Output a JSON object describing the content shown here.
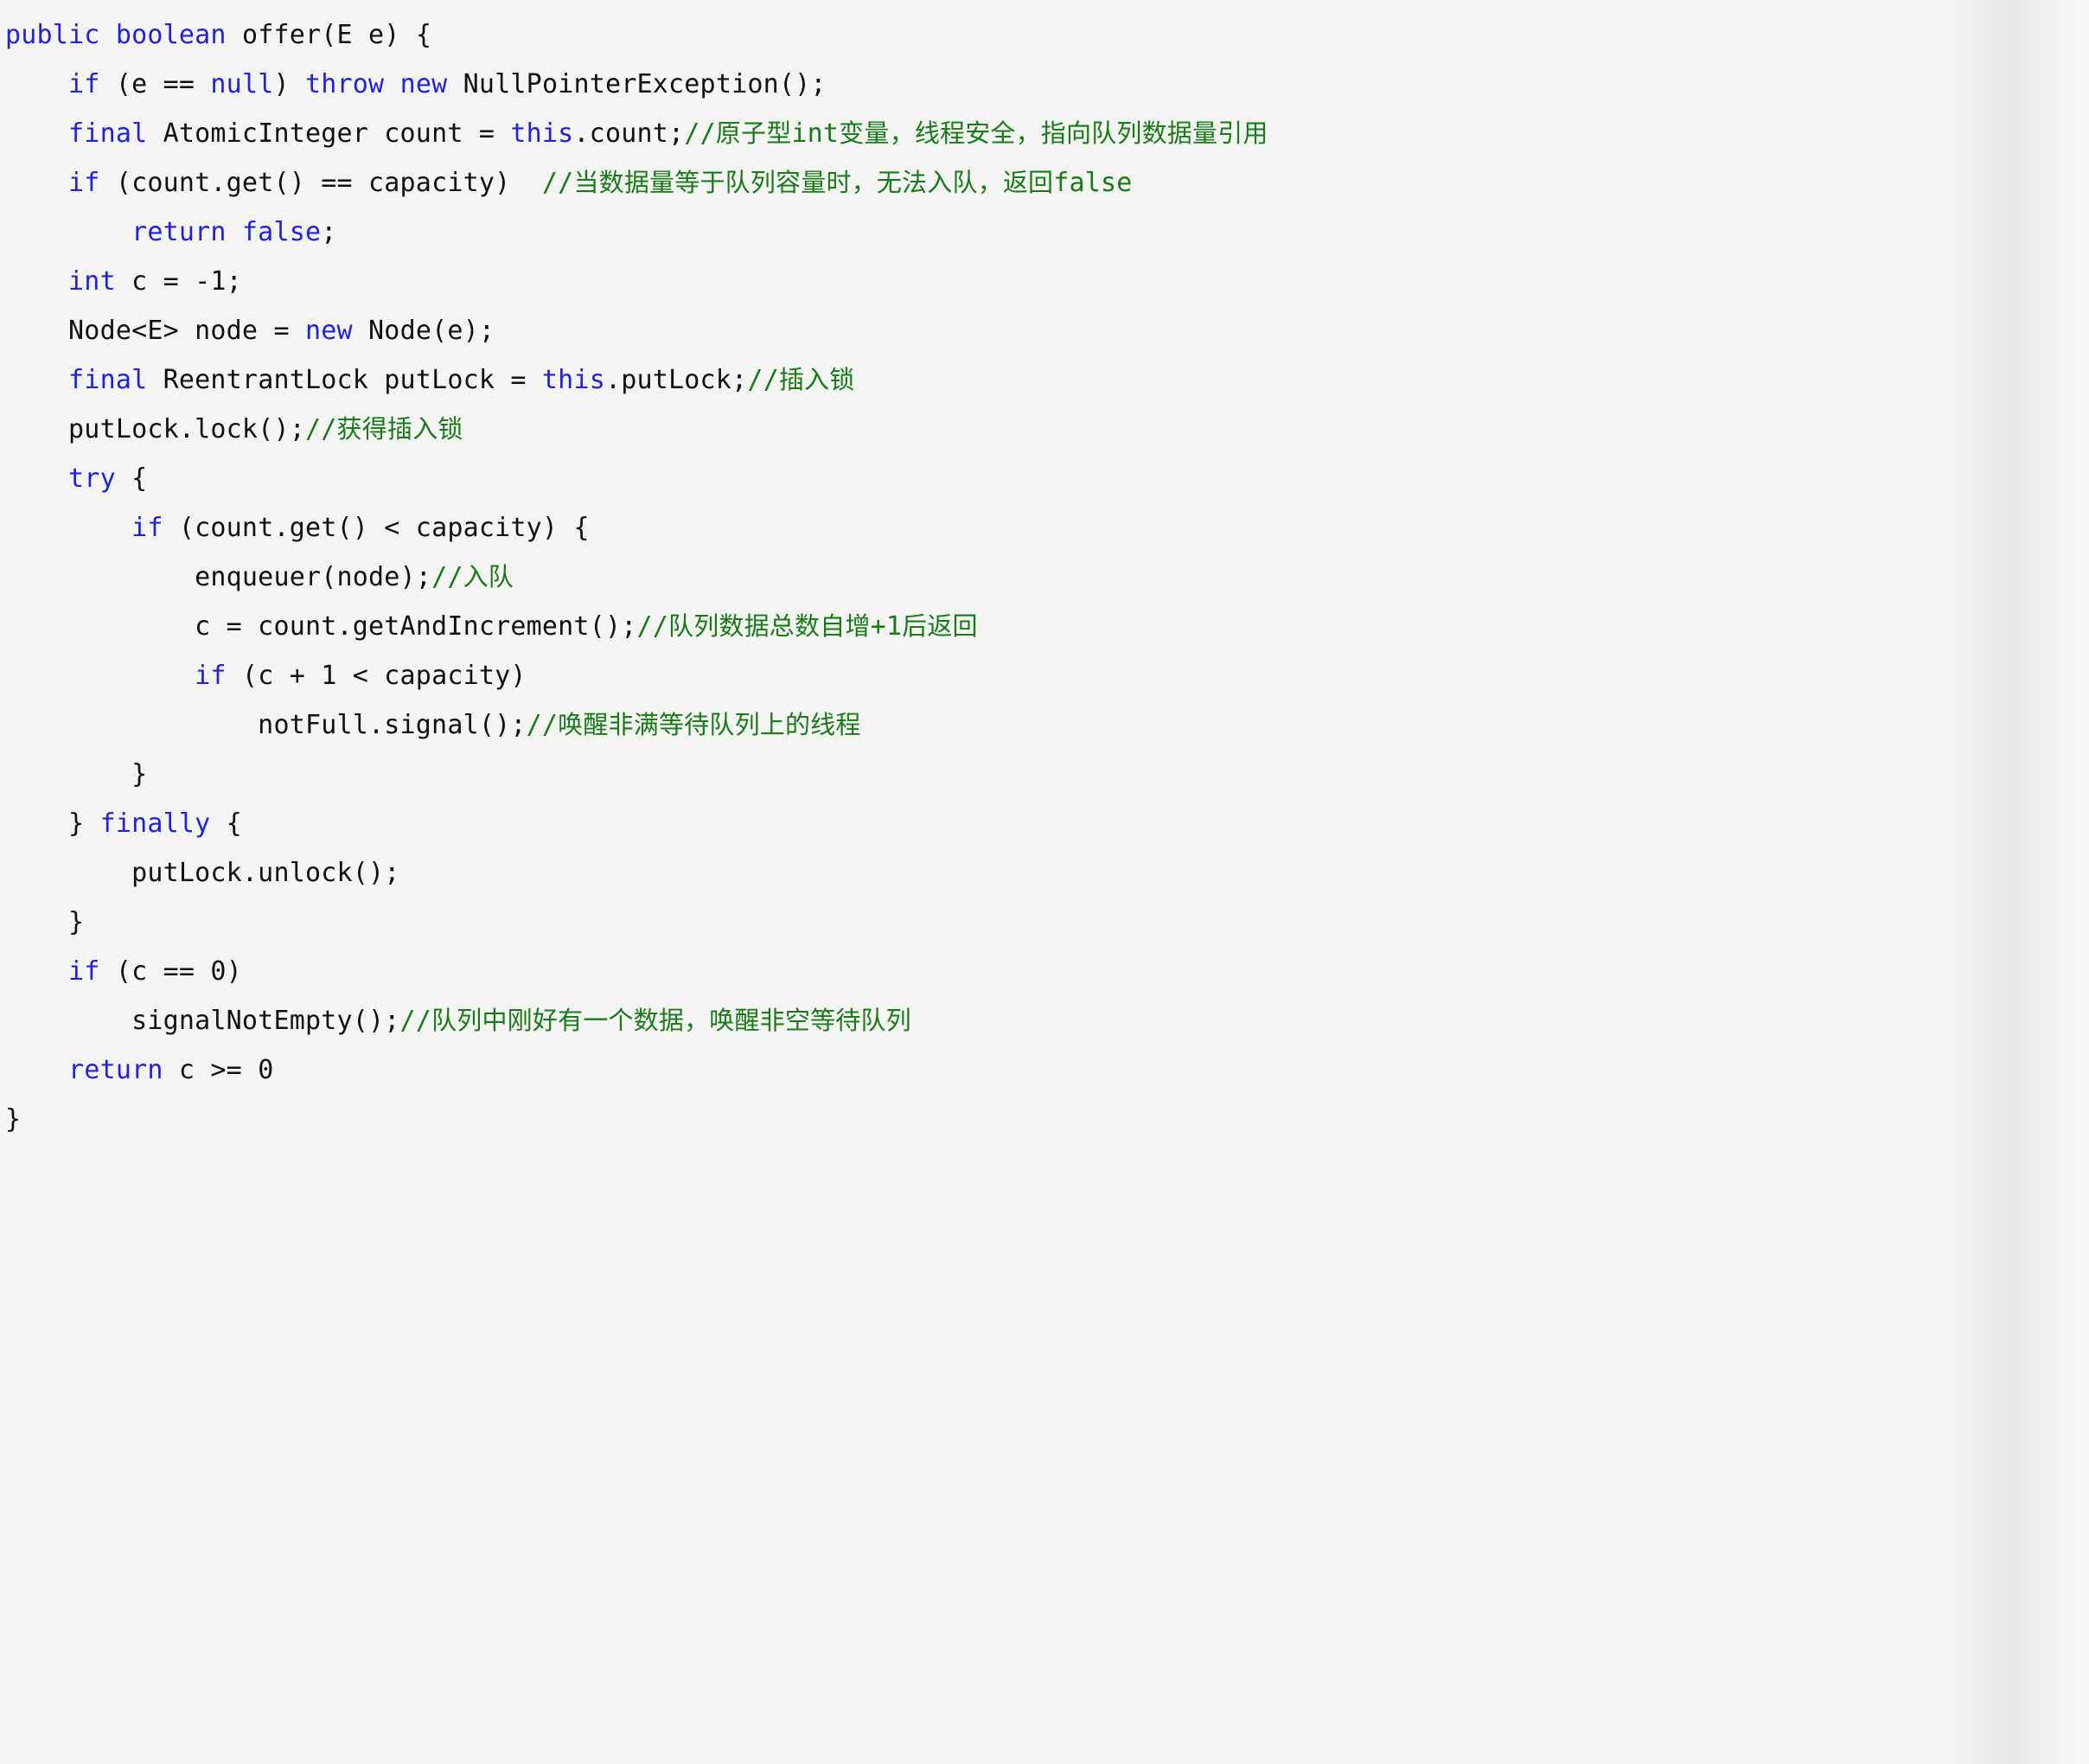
{
  "document": {
    "language": "java",
    "kind": "code-snippet",
    "background_color": "#f4f4f3",
    "colors": {
      "keyword": "#2222dd",
      "identifier": "#111111",
      "comment": "#1a7a1a"
    }
  },
  "code": {
    "lines": [
      {
        "n": 1,
        "indent": 0,
        "text": "public boolean offer(E e) {",
        "tokens": [
          {
            "t": "kw",
            "v": "public"
          },
          {
            "t": "id",
            "v": " "
          },
          {
            "t": "kw",
            "v": "boolean"
          },
          {
            "t": "id",
            "v": " offer(E e) {"
          }
        ]
      },
      {
        "n": 2,
        "indent": 1,
        "text": "if (e == null) throw new NullPointerException();",
        "tokens": [
          {
            "t": "id",
            "v": "    "
          },
          {
            "t": "kw",
            "v": "if"
          },
          {
            "t": "id",
            "v": " (e == "
          },
          {
            "t": "kw",
            "v": "null"
          },
          {
            "t": "id",
            "v": ") "
          },
          {
            "t": "kw",
            "v": "throw"
          },
          {
            "t": "id",
            "v": " "
          },
          {
            "t": "kw",
            "v": "new"
          },
          {
            "t": "id",
            "v": " NullPointerException();"
          }
        ]
      },
      {
        "n": 3,
        "indent": 1,
        "text": "final AtomicInteger count = this.count;//原子型int变量，线程安全，指向队列数据量引用",
        "tokens": [
          {
            "t": "id",
            "v": "    "
          },
          {
            "t": "kw",
            "v": "final"
          },
          {
            "t": "id",
            "v": " AtomicInteger count = "
          },
          {
            "t": "kw",
            "v": "this"
          },
          {
            "t": "id",
            "v": ".count;"
          },
          {
            "t": "cmt-mono",
            "v": "//"
          },
          {
            "t": "cmt",
            "v": "原子型"
          },
          {
            "t": "cmt-mono",
            "v": "int"
          },
          {
            "t": "cmt",
            "v": "变量，线程安全，指向队列数据量引用"
          }
        ]
      },
      {
        "n": 4,
        "indent": 1,
        "text": "if (count.get() == capacity)  //当数据量等于队列容量时，无法入队，返回false",
        "tokens": [
          {
            "t": "id",
            "v": "    "
          },
          {
            "t": "kw",
            "v": "if"
          },
          {
            "t": "id",
            "v": " (count.get() == capacity)  "
          },
          {
            "t": "cmt-mono",
            "v": "//"
          },
          {
            "t": "cmt",
            "v": "当数据量等于队列容量时，无法入队，返回"
          },
          {
            "t": "cmt-mono",
            "v": "false"
          }
        ]
      },
      {
        "n": 5,
        "indent": 2,
        "text": "return false;",
        "tokens": [
          {
            "t": "id",
            "v": "        "
          },
          {
            "t": "kw",
            "v": "return false"
          },
          {
            "t": "id",
            "v": ";"
          }
        ]
      },
      {
        "n": 6,
        "indent": 1,
        "text": "int c = -1;",
        "tokens": [
          {
            "t": "id",
            "v": "    "
          },
          {
            "t": "kw",
            "v": "int"
          },
          {
            "t": "id",
            "v": " c = -1;"
          }
        ]
      },
      {
        "n": 7,
        "indent": 1,
        "text": "Node<E> node = new Node(e);",
        "tokens": [
          {
            "t": "id",
            "v": "    Node<E> node = "
          },
          {
            "t": "kw",
            "v": "new"
          },
          {
            "t": "id",
            "v": " Node(e);"
          }
        ]
      },
      {
        "n": 8,
        "indent": 1,
        "text": "final ReentrantLock putLock = this.putLock;//插入锁",
        "tokens": [
          {
            "t": "id",
            "v": "    "
          },
          {
            "t": "kw",
            "v": "final"
          },
          {
            "t": "id",
            "v": " ReentrantLock putLock = "
          },
          {
            "t": "kw",
            "v": "this"
          },
          {
            "t": "id",
            "v": ".putLock;"
          },
          {
            "t": "cmt-mono",
            "v": "//"
          },
          {
            "t": "cmt",
            "v": "插入锁"
          }
        ]
      },
      {
        "n": 9,
        "indent": 1,
        "text": "putLock.lock();//获得插入锁",
        "tokens": [
          {
            "t": "id",
            "v": "    putLock.lock();"
          },
          {
            "t": "cmt-mono",
            "v": "//"
          },
          {
            "t": "cmt",
            "v": "获得插入锁"
          }
        ]
      },
      {
        "n": 10,
        "indent": 1,
        "text": "try {",
        "tokens": [
          {
            "t": "id",
            "v": "    "
          },
          {
            "t": "kw",
            "v": "try"
          },
          {
            "t": "id",
            "v": " {"
          }
        ]
      },
      {
        "n": 11,
        "indent": 2,
        "text": "if (count.get() < capacity) {",
        "tokens": [
          {
            "t": "id",
            "v": "        "
          },
          {
            "t": "kw",
            "v": "if"
          },
          {
            "t": "id",
            "v": " (count.get() < capacity) {"
          }
        ]
      },
      {
        "n": 12,
        "indent": 3,
        "text": "enqueuer(node);//入队",
        "tokens": [
          {
            "t": "id",
            "v": "            enqueuer(node);"
          },
          {
            "t": "cmt-mono",
            "v": "//"
          },
          {
            "t": "cmt",
            "v": "入队"
          }
        ]
      },
      {
        "n": 13,
        "indent": 3,
        "text": "c = count.getAndIncrement();//队列数据总数自增+1后返回",
        "tokens": [
          {
            "t": "id",
            "v": "            c = count.getAndIncrement();"
          },
          {
            "t": "cmt-mono",
            "v": "//"
          },
          {
            "t": "cmt",
            "v": "队列数据总数自增"
          },
          {
            "t": "cmt-mono",
            "v": "+1"
          },
          {
            "t": "cmt",
            "v": "后返回"
          }
        ]
      },
      {
        "n": 14,
        "indent": 3,
        "text": "if (c + 1 < capacity)",
        "tokens": [
          {
            "t": "id",
            "v": "            "
          },
          {
            "t": "kw",
            "v": "if"
          },
          {
            "t": "id",
            "v": " (c + 1 < capacity)"
          }
        ]
      },
      {
        "n": 15,
        "indent": 4,
        "text": "notFull.signal();//唤醒非满等待队列上的线程",
        "tokens": [
          {
            "t": "id",
            "v": "                notFull.signal();"
          },
          {
            "t": "cmt-mono",
            "v": "//"
          },
          {
            "t": "cmt",
            "v": "唤醒非满等待队列上的线程"
          }
        ]
      },
      {
        "n": 16,
        "indent": 2,
        "text": "}",
        "tokens": [
          {
            "t": "id",
            "v": "        }"
          }
        ]
      },
      {
        "n": 17,
        "indent": 1,
        "text": "} finally {",
        "tokens": [
          {
            "t": "id",
            "v": "    } "
          },
          {
            "t": "kw",
            "v": "finally"
          },
          {
            "t": "id",
            "v": " {"
          }
        ]
      },
      {
        "n": 18,
        "indent": 2,
        "text": "putLock.unlock();",
        "tokens": [
          {
            "t": "id",
            "v": "        putLock.unlock();"
          }
        ]
      },
      {
        "n": 19,
        "indent": 1,
        "text": "}",
        "tokens": [
          {
            "t": "id",
            "v": "    }"
          }
        ]
      },
      {
        "n": 20,
        "indent": 1,
        "text": "if (c == 0)",
        "tokens": [
          {
            "t": "id",
            "v": "    "
          },
          {
            "t": "kw",
            "v": "if"
          },
          {
            "t": "id",
            "v": " (c == 0)"
          }
        ]
      },
      {
        "n": 21,
        "indent": 2,
        "text": "signalNotEmpty();//队列中刚好有一个数据，唤醒非空等待队列",
        "tokens": [
          {
            "t": "id",
            "v": "        signalNotEmpty();"
          },
          {
            "t": "cmt-mono",
            "v": "//"
          },
          {
            "t": "cmt",
            "v": "队列中刚好有一个数据，唤醒非空等待队列"
          }
        ]
      },
      {
        "n": 22,
        "indent": 1,
        "text": "return c >= 0",
        "tokens": [
          {
            "t": "id",
            "v": "    "
          },
          {
            "t": "kw",
            "v": "return"
          },
          {
            "t": "id",
            "v": " c >= 0"
          }
        ]
      },
      {
        "n": 23,
        "indent": 0,
        "text": "}",
        "tokens": [
          {
            "t": "id",
            "v": "}"
          }
        ]
      }
    ]
  }
}
